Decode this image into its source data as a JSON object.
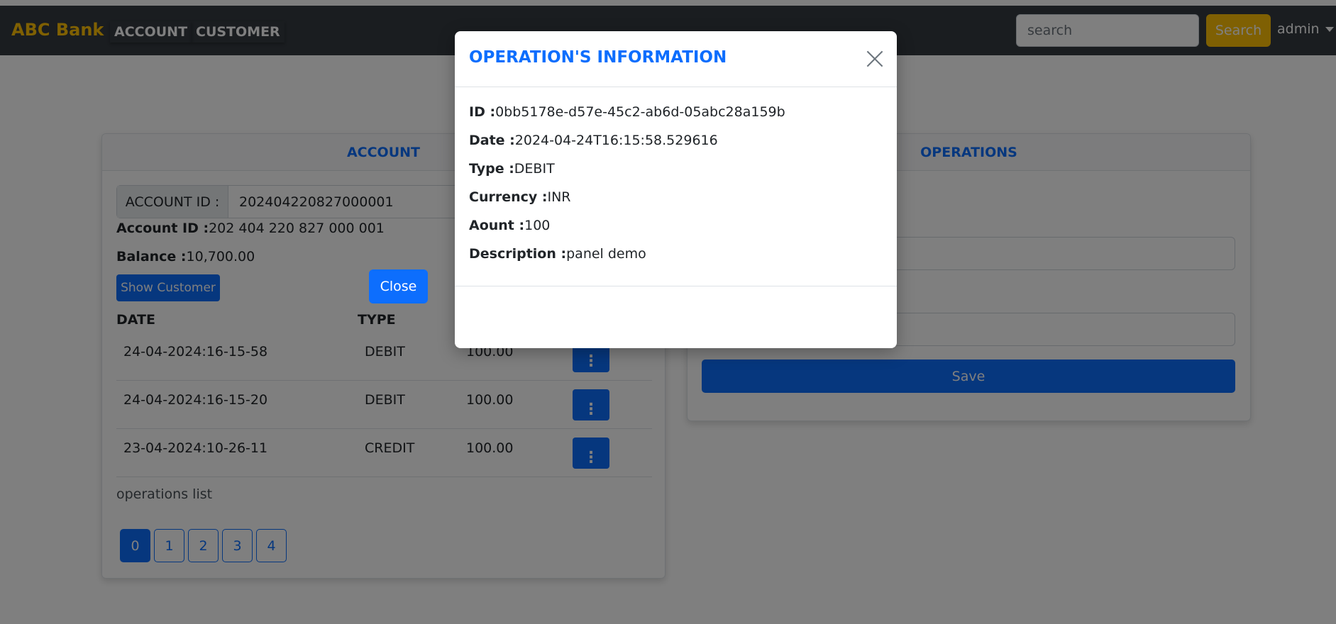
{
  "navbar": {
    "brand": "ABC Bank",
    "links": [
      "ACCOUNT",
      "CUSTOMER"
    ],
    "search_placeholder": "search",
    "search_button": "Search",
    "user": "admin"
  },
  "account_card": {
    "header": "ACCOUNT",
    "id_label": "ACCOUNT ID :",
    "id_value": "202404220827000001",
    "account_id_label": "Account ID :",
    "account_id_value": "202 404 220 827 000 001",
    "balance_label": "Balance :",
    "balance_value": "10,700.00",
    "show_customer": "Show Customer",
    "columns": [
      "DATE",
      "TYPE"
    ],
    "rows": [
      {
        "date": "24-04-2024:16-15-58",
        "type": "DEBIT",
        "amount": "100.00"
      },
      {
        "date": "24-04-2024:16-15-20",
        "type": "DEBIT",
        "amount": "100.00"
      },
      {
        "date": "23-04-2024:10-26-11",
        "type": "CREDIT",
        "amount": "100.00"
      }
    ],
    "list_label": "operations list",
    "pages": [
      "0",
      "1",
      "2",
      "3",
      "4"
    ]
  },
  "operations_card": {
    "header": "OPERATIONS",
    "save": "Save"
  },
  "modal": {
    "title": "OPERATION'S INFORMATION",
    "fields": [
      {
        "label": "ID :",
        "value": "0bb5178e-d57e-45c2-ab6d-05abc28a159b"
      },
      {
        "label": "Date :",
        "value": "2024-04-24T16:15:58.529616"
      },
      {
        "label": "Type :",
        "value": "DEBIT"
      },
      {
        "label": "Currency :",
        "value": "INR"
      },
      {
        "label": "Aount :",
        "value": "100"
      },
      {
        "label": "Description :",
        "value": "panel demo"
      }
    ],
    "close_button": "Close"
  },
  "colors": {
    "primary": "#0d6efd",
    "brand": "#ffc107",
    "navbar": "#343a40"
  }
}
